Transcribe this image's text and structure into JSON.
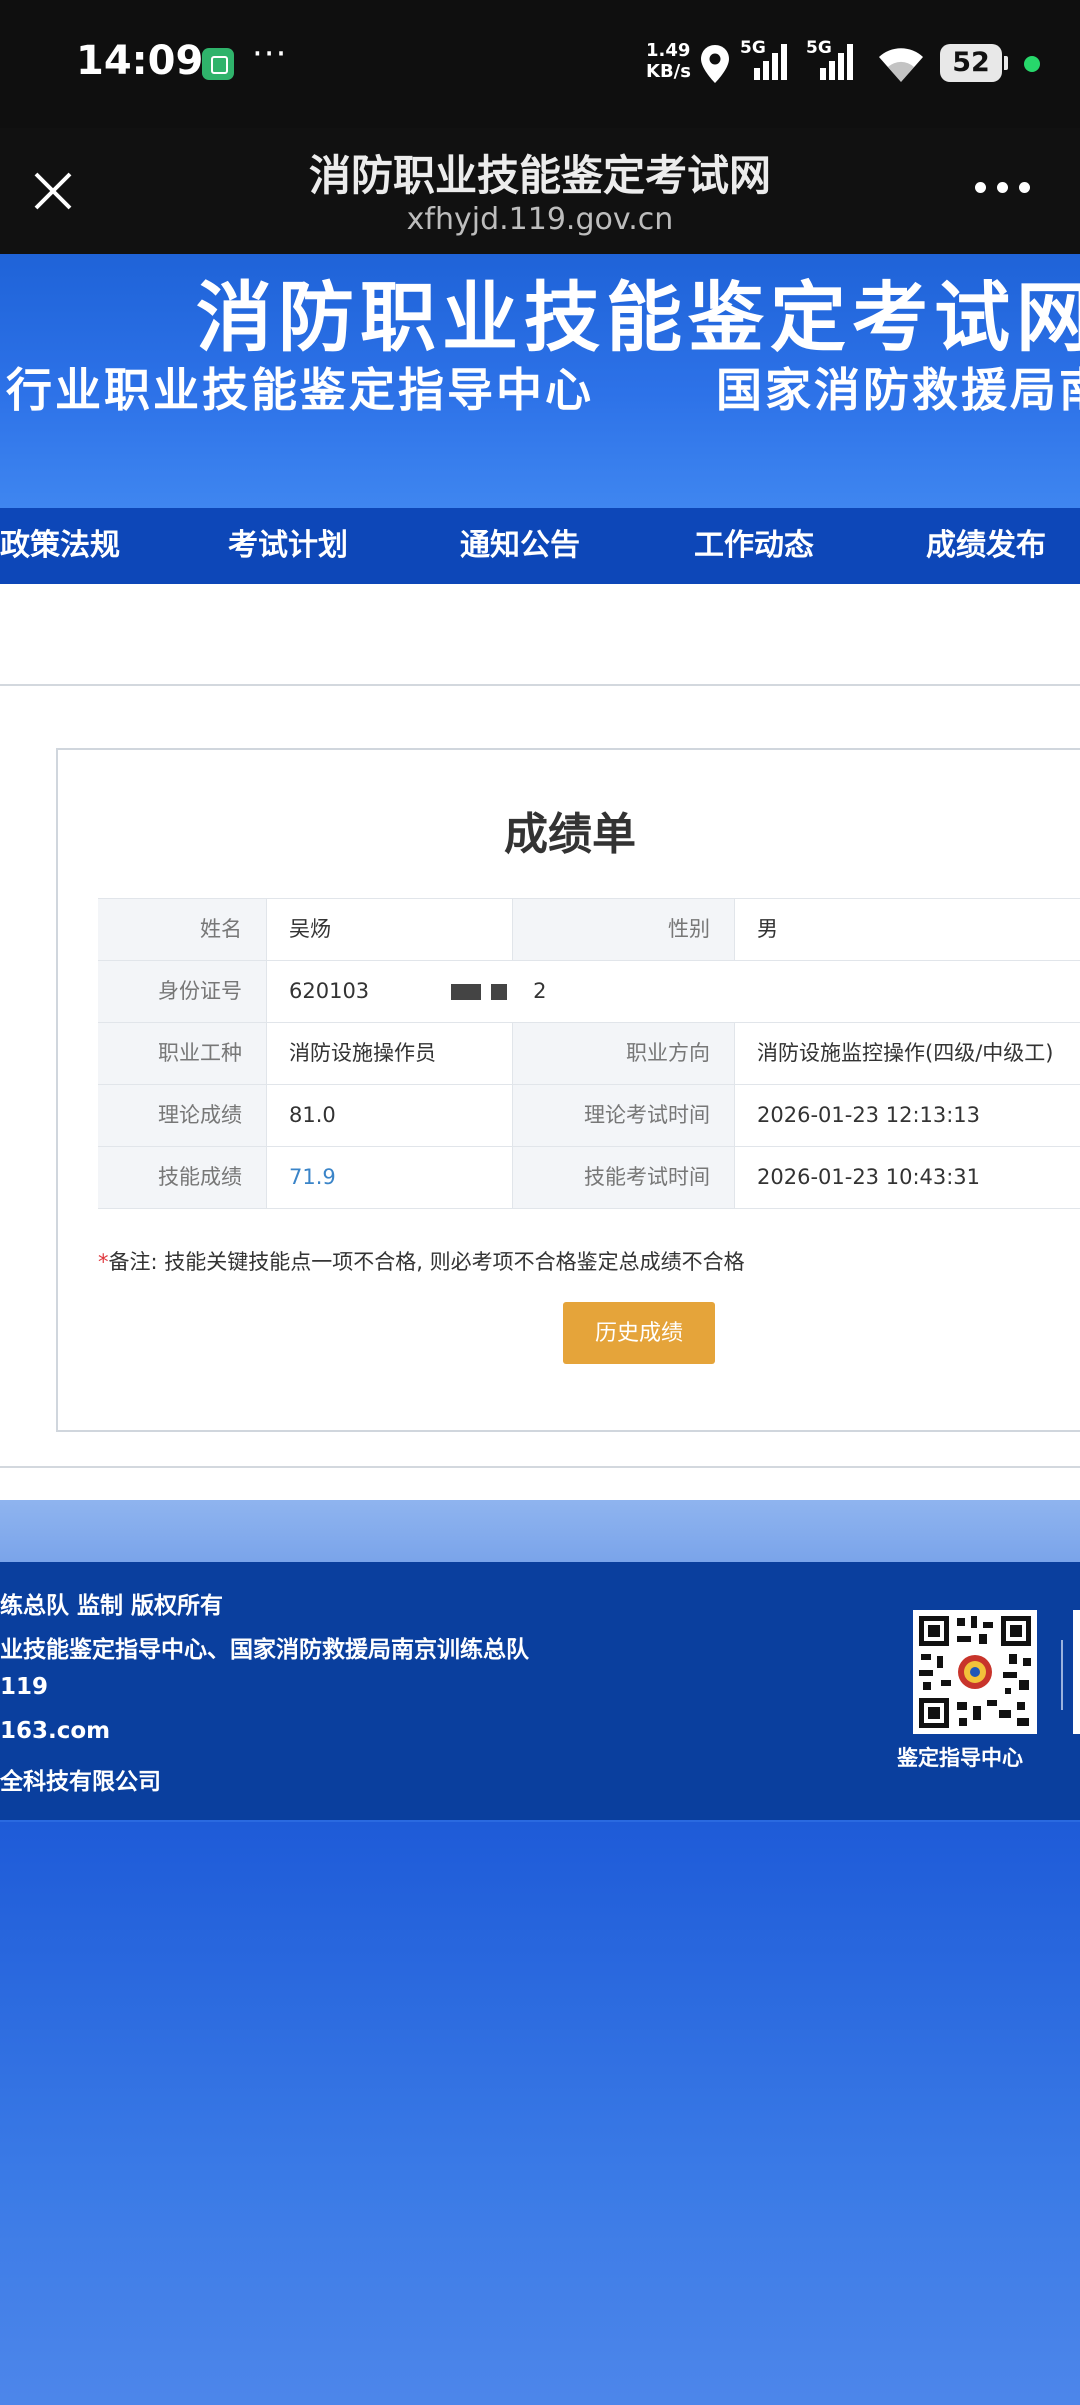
{
  "status_bar": {
    "time": "14:09",
    "dots": "···",
    "net_speed_value": "1.49",
    "net_speed_unit": "KB/s",
    "sim1_label": "5G",
    "sim2_label": "5G",
    "battery": "52",
    "accent_color": "#27d86b"
  },
  "browser": {
    "title": "消防职业技能鉴定考试网",
    "url": "xfhyjd.119.gov.cn",
    "close_icon": "close-icon",
    "more_icon": "more-dots-icon"
  },
  "banner": {
    "title": "消防职业技能鉴定考试网",
    "sub_left": "行业职业技能鉴定指导中心",
    "sub_right": "国家消防救援局南"
  },
  "nav": {
    "items": [
      "政策法规",
      "考试计划",
      "通知公告",
      "工作动态",
      "成绩发布"
    ]
  },
  "score": {
    "title": "成绩单",
    "name_label": "姓名",
    "name_value": "吴炀",
    "gender_label": "性别",
    "gender_value": "男",
    "id_label": "身份证号",
    "id_prefix": "620103",
    "id_suffix": "2",
    "job_label": "职业工种",
    "job_value": "消防设施操作员",
    "direction_label": "职业方向",
    "direction_value": "消防设施监控操作(四级/中级工)",
    "theory_label": "理论成绩",
    "theory_value": "81.0",
    "theory_time_label": "理论考试时间",
    "theory_time_value": "2026-01-23 12:13:13",
    "skill_label": "技能成绩",
    "skill_value": "71.9",
    "skill_time_label": "技能考试时间",
    "skill_time_value": "2026-01-23 10:43:31",
    "note_star": "*",
    "note_text": "备注: 技能关键技能点一项不合格, 则必考项不合格鉴定总成绩不合格",
    "history_button": "历史成绩",
    "button_color": "#e5a43a",
    "skill_value_color": "#3a84c8"
  },
  "footer": {
    "lines": [
      "练总队 监制 版权所有",
      "业技能鉴定指导中心、国家消防救援局南京训练总队",
      "119",
      "163.com",
      "全科技有限公司"
    ],
    "qr_label": "鉴定指导中心",
    "bg_color": "#0a3f9e"
  }
}
